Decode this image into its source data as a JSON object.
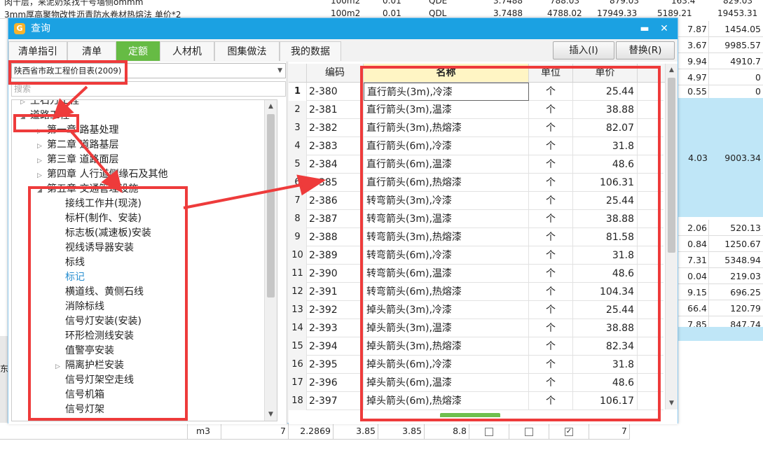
{
  "background_sheet": {
    "top_rows": [
      {
        "text": "肉十层，来泥奶浆找十号墙侧ommm",
        "c2": "100m2",
        "c3": "0.01",
        "c4": "QDE",
        "c5": "3.7488",
        "c6": "788.03",
        "c7": "879.03",
        "c8": "163.4",
        "c9": "829.03"
      },
      {
        "text": "3mm厚高聚物改性沥青防水卷材热熔法  单价*2",
        "c2": "100m2",
        "c3": "0.01",
        "c4": "QDL",
        "c5": "3.7488",
        "c6": "4788.02",
        "c7": "17949.33",
        "c8": "5189.21",
        "c9": "19453.31"
      }
    ],
    "right_rows": [
      {
        "a": "7.87",
        "b": "1454.05"
      },
      {
        "a": "3.67",
        "b": "9985.57"
      },
      {
        "a": "9.94",
        "b": "4910.7"
      },
      {
        "a": "4.97",
        "b": "0"
      },
      {
        "a": "0.55",
        "b": "0"
      }
    ],
    "highlight_row": {
      "a": "4.03",
      "b": "9003.34"
    },
    "right_rows_lower": [
      {
        "a": "2.06",
        "b": "520.13"
      },
      {
        "a": "0.84",
        "b": "1250.67"
      },
      {
        "a": "7.31",
        "b": "5348.94"
      },
      {
        "a": "0.04",
        "b": "219.03"
      },
      {
        "a": "9.15",
        "b": "696.25"
      },
      {
        "a": "66.4",
        "b": "120.79"
      },
      {
        "a": "7.85",
        "b": "847.74"
      }
    ],
    "left_fragment": "东",
    "bottom_row": {
      "unit": "m3",
      "qty": "7",
      "v1": "2.2869",
      "v2": "3.85",
      "v3": "3.85",
      "v4": "8.8",
      "last": "7"
    }
  },
  "dialog": {
    "title": "查询",
    "icon": "app-logo-icon",
    "minimize_glyph": "▬",
    "close_glyph": "✕",
    "tabs": [
      {
        "label": "清单指引",
        "active": false
      },
      {
        "label": "清单",
        "active": false
      },
      {
        "label": "定额",
        "active": true
      },
      {
        "label": "人材机",
        "active": false
      },
      {
        "label": "图集做法",
        "active": false
      },
      {
        "label": "我的数据",
        "active": false
      }
    ],
    "insert_button": "插入(I)",
    "replace_button": "替换(R)",
    "library_select": "陕西省市政工程价目表(2009)",
    "search_placeholder": "搜索",
    "tree": [
      {
        "label": "土石方工程",
        "level": 0,
        "twisty": "▷"
      },
      {
        "label": "道路工程",
        "level": 0,
        "twisty": "◢"
      },
      {
        "label": "第一章  路基处理",
        "level": 1,
        "twisty": "▷"
      },
      {
        "label": "第二章  道路基层",
        "level": 1,
        "twisty": "▷"
      },
      {
        "label": "第三章  道路面层",
        "level": 1,
        "twisty": "▷"
      },
      {
        "label": "第四章  人行道侧缘石及其他",
        "level": 1,
        "twisty": "▷"
      },
      {
        "label": "第五章  交通管理设施",
        "level": 1,
        "twisty": "◢"
      },
      {
        "label": "接线工作井(现浇)",
        "level": 2,
        "twisty": ""
      },
      {
        "label": "标杆(制作、安装)",
        "level": 2,
        "twisty": ""
      },
      {
        "label": "标志板(减速板)安装",
        "level": 2,
        "twisty": ""
      },
      {
        "label": "视线诱导器安装",
        "level": 2,
        "twisty": ""
      },
      {
        "label": "标线",
        "level": 2,
        "twisty": ""
      },
      {
        "label": "标记",
        "level": 2,
        "twisty": "",
        "highlight": true
      },
      {
        "label": "横道线、黄侧石线",
        "level": 2,
        "twisty": ""
      },
      {
        "label": "消除标线",
        "level": 2,
        "twisty": ""
      },
      {
        "label": "信号灯安装(安装)",
        "level": 2,
        "twisty": ""
      },
      {
        "label": "环形检测线安装",
        "level": 2,
        "twisty": ""
      },
      {
        "label": "值警亭安装",
        "level": 2,
        "twisty": ""
      },
      {
        "label": "隔离护栏安装",
        "level": 1,
        "twisty": "▷",
        "indent_extra": true
      },
      {
        "label": "信号灯架空走线",
        "level": 2,
        "twisty": ""
      },
      {
        "label": "信号机箱",
        "level": 2,
        "twisty": ""
      },
      {
        "label": "信号灯架",
        "level": 2,
        "twisty": ""
      }
    ],
    "grid": {
      "columns": [
        "",
        "编码",
        "名称",
        "单位",
        "单价"
      ],
      "rows": [
        {
          "n": "1",
          "code": "2-380",
          "name": "直行箭头(3m),冷漆",
          "unit": "个",
          "price": "25.44"
        },
        {
          "n": "2",
          "code": "2-381",
          "name": "直行箭头(3m),温漆",
          "unit": "个",
          "price": "38.88"
        },
        {
          "n": "3",
          "code": "2-382",
          "name": "直行箭头(3m),热熔漆",
          "unit": "个",
          "price": "82.07"
        },
        {
          "n": "4",
          "code": "2-383",
          "name": "直行箭头(6m),冷漆",
          "unit": "个",
          "price": "31.8"
        },
        {
          "n": "5",
          "code": "2-384",
          "name": "直行箭头(6m),温漆",
          "unit": "个",
          "price": "48.6"
        },
        {
          "n": "6",
          "code": "2-385",
          "name": "直行箭头(6m),热熔漆",
          "unit": "个",
          "price": "106.31"
        },
        {
          "n": "7",
          "code": "2-386",
          "name": "转弯箭头(3m),冷漆",
          "unit": "个",
          "price": "25.44"
        },
        {
          "n": "8",
          "code": "2-387",
          "name": "转弯箭头(3m),温漆",
          "unit": "个",
          "price": "38.88"
        },
        {
          "n": "9",
          "code": "2-388",
          "name": "转弯箭头(3m),热熔漆",
          "unit": "个",
          "price": "81.58"
        },
        {
          "n": "10",
          "code": "2-389",
          "name": "转弯箭头(6m),冷漆",
          "unit": "个",
          "price": "31.8"
        },
        {
          "n": "11",
          "code": "2-390",
          "name": "转弯箭头(6m),温漆",
          "unit": "个",
          "price": "48.6"
        },
        {
          "n": "12",
          "code": "2-391",
          "name": "转弯箭头(6m),热熔漆",
          "unit": "个",
          "price": "104.34"
        },
        {
          "n": "13",
          "code": "2-392",
          "name": "掉头箭头(3m),冷漆",
          "unit": "个",
          "price": "25.44"
        },
        {
          "n": "14",
          "code": "2-393",
          "name": "掉头箭头(3m),温漆",
          "unit": "个",
          "price": "38.88"
        },
        {
          "n": "15",
          "code": "2-394",
          "name": "掉头箭头(3m),热熔漆",
          "unit": "个",
          "price": "82.34"
        },
        {
          "n": "16",
          "code": "2-395",
          "name": "掉头箭头(6m),冷漆",
          "unit": "个",
          "price": "31.8"
        },
        {
          "n": "17",
          "code": "2-396",
          "name": "掉头箭头(6m),温漆",
          "unit": "个",
          "price": "48.6"
        },
        {
          "n": "18",
          "code": "2-397",
          "name": "掉头箭头(6m),热熔漆",
          "unit": "个",
          "price": "106.17"
        }
      ]
    }
  },
  "colors": {
    "titlebar": "#1ba1e2",
    "active_tab": "#66bb44",
    "annotation_red": "#ee3b3b",
    "selected_header": "#fff5c4",
    "tree_highlight": "#2a8fd0"
  }
}
